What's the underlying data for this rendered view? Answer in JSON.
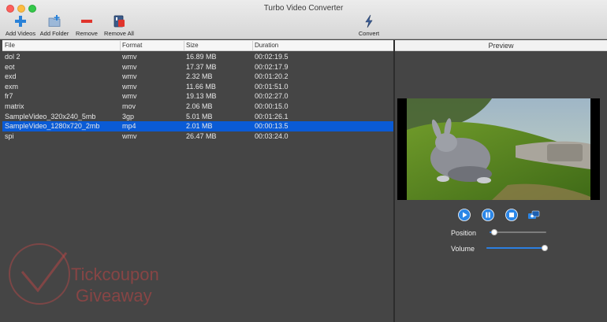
{
  "window": {
    "title": "Turbo Video Converter"
  },
  "toolbar": {
    "add_videos": "Add Videos",
    "add_folder": "Add Folder",
    "remove": "Remove",
    "remove_all": "Remove All",
    "convert": "Convert"
  },
  "table": {
    "headers": {
      "file": "File",
      "format": "Format",
      "size": "Size",
      "duration": "Duration"
    },
    "rows": [
      {
        "file": "dol 2",
        "format": "wmv",
        "size": "16.89 MB",
        "duration": "00:02:19.5"
      },
      {
        "file": "eot",
        "format": "wmv",
        "size": "17.37 MB",
        "duration": "00:02:17.9"
      },
      {
        "file": "exd",
        "format": "wmv",
        "size": "2.32 MB",
        "duration": "00:01:20.2"
      },
      {
        "file": "exm",
        "format": "wmv",
        "size": "11.66 MB",
        "duration": "00:01:51.0"
      },
      {
        "file": "fr7",
        "format": "wmv",
        "size": "19.13 MB",
        "duration": "00:02:27.0"
      },
      {
        "file": "matrix",
        "format": "mov",
        "size": "2.06 MB",
        "duration": "00:00:15.0"
      },
      {
        "file": "SampleVideo_320x240_5mb",
        "format": "3gp",
        "size": "5.01 MB",
        "duration": "00:01:26.1"
      },
      {
        "file": "SampleVideo_1280x720_2mb",
        "format": "mp4",
        "size": "2.01 MB",
        "duration": "00:00:13.5"
      },
      {
        "file": "spi",
        "format": "wmv",
        "size": "26.47 MB",
        "duration": "00:03:24.0"
      }
    ],
    "selected_index": 7
  },
  "preview": {
    "title": "Preview",
    "position_label": "Position",
    "volume_label": "Volume",
    "position_fraction": 0.08,
    "volume_fraction": 1.0
  },
  "watermark": {
    "line1": "Tickcoupon",
    "line2": "Giveaway"
  },
  "colors": {
    "selection": "#0a5bd6",
    "add_icon": "#2a82d8",
    "remove_icon": "#e0342c",
    "control_blue": "#2b86e6"
  }
}
